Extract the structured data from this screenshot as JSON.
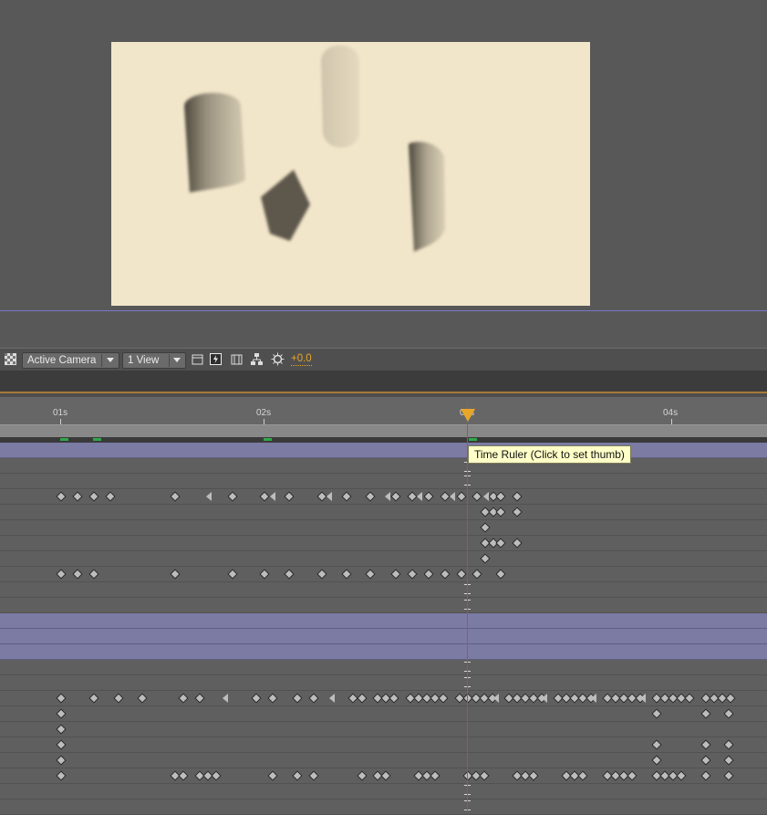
{
  "viewer_toolbar": {
    "camera_dropdown": "Active Camera",
    "view_dropdown": "1 View",
    "exposure": "+0.0"
  },
  "time_ruler": {
    "ticks": [
      "01s",
      "02s",
      "03s",
      "04s"
    ],
    "tooltip": "Time Ruler (Click to set thumb)"
  }
}
